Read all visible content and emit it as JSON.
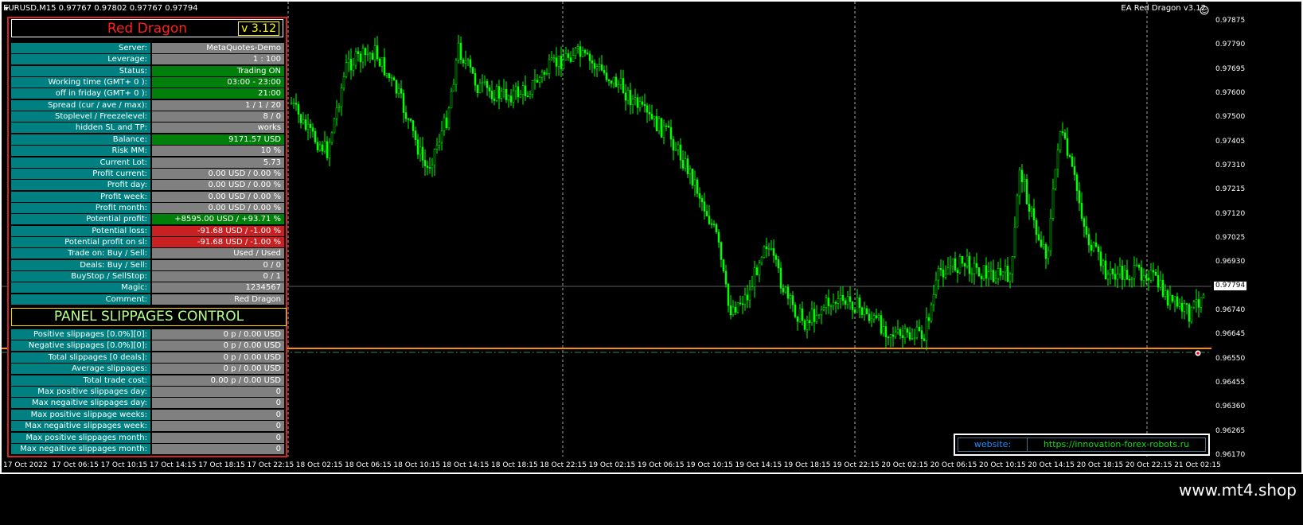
{
  "symbol": {
    "text": "EURUSD,M15  0.97767 0.97802 0.97767 0.97794"
  },
  "ea_label": "EA Red Dragon v3.12",
  "panel": {
    "title": "Red Dragon",
    "version": "v 3.12",
    "rows": [
      {
        "label": "Server:",
        "value": "MetaQuotes-Demo",
        "style": "gray"
      },
      {
        "label": "Leverage:",
        "value": "1 : 100",
        "style": "gray"
      },
      {
        "label": "Status:",
        "value": "Trading ON",
        "style": "green"
      },
      {
        "label": "Working time (GMT+ 0 ):",
        "value": "03:00 - 23:00",
        "style": "green"
      },
      {
        "label": "off in friday (GMT+ 0 ):",
        "value": "21:00",
        "style": "green"
      },
      {
        "label": "Spread (cur / ave / max):",
        "value": "1 / 1 / 20",
        "style": "gray"
      },
      {
        "label": "Stoplevel  /  Freezelevel:",
        "value": "8  /  0",
        "style": "gray"
      },
      {
        "label": "hidden SL and TP:",
        "value": "works",
        "style": "gray"
      },
      {
        "label": "Balance:",
        "value": "9171.57 USD",
        "style": "green"
      },
      {
        "label": "Risk MM:",
        "value": "10 %",
        "style": "gray"
      },
      {
        "label": "Current Lot:",
        "value": "5.73",
        "style": "gray"
      },
      {
        "label": "Profit current:",
        "value": "0.00 USD / 0.00 %",
        "style": "gray"
      },
      {
        "label": "Profit day:",
        "value": "0.00 USD / 0.00 %",
        "style": "gray"
      },
      {
        "label": "Profit week:",
        "value": "0.00 USD / 0.00 %",
        "style": "gray"
      },
      {
        "label": "Profit month:",
        "value": "0.00 USD / 0.00 %",
        "style": "gray"
      },
      {
        "label": "Potential profit:",
        "value": "+8595.00 USD / +93.71 %",
        "style": "green"
      },
      {
        "label": "Potential loss:",
        "value": "-91.68 USD / -1.00 %",
        "style": "red"
      },
      {
        "label": "Potential profit on sl:",
        "value": "-91.68 USD / -1.00 %",
        "style": "red"
      },
      {
        "label": "Trade on: Buy  /  Sell:",
        "value": "Used  /  Used",
        "style": "gray"
      },
      {
        "label": "Deals: Buy / Sell:",
        "value": "0  /  0",
        "style": "gray"
      },
      {
        "label": "BuyStop / SellStop:",
        "value": "0  /  1",
        "style": "gray"
      },
      {
        "label": "Magic:",
        "value": "1234567",
        "style": "gray"
      },
      {
        "label": "Comment:",
        "value": "Red Dragon",
        "style": "gray"
      }
    ],
    "slippage_title": "PANEL SLIPPAGES CONTROL",
    "slippage_rows": [
      {
        "label": "Positive slippages [0.0%][0]:",
        "value": "0 p / 0.00 USD"
      },
      {
        "label": "Negative slippages [0.0%][0]:",
        "value": "0 p / 0.00 USD"
      },
      {
        "label": "Total slippages [0 deals]:",
        "value": "0 p / 0.00 USD"
      },
      {
        "label": "Average slippages:",
        "value": "0 p / 0.00 USD"
      },
      {
        "label": "Total trade cost:",
        "value": "0.00 p / 0.00 USD"
      },
      {
        "label": "Max positive slippages day:",
        "value": "0"
      },
      {
        "label": "Max negaitive slippages day:",
        "value": "0"
      },
      {
        "label": "Max positive slippage weeks:",
        "value": "0"
      },
      {
        "label": "Max negaitive slippages week:",
        "value": "0"
      },
      {
        "label": "Max positive slippages month:",
        "value": "0"
      },
      {
        "label": "Max negaitive slippages month:",
        "value": "0"
      }
    ]
  },
  "website": {
    "label": "website:",
    "url": "https://innovation-forex-robots.ru"
  },
  "price_scale": [
    "0.97875",
    "0.97790",
    "0.97695",
    "0.97600",
    "0.97500",
    "0.97405",
    "0.97310",
    "0.97215",
    "0.97120",
    "0.97025",
    "0.96930",
    "0.96835",
    "0.96740",
    "0.96645",
    "0.96550",
    "0.96455",
    "0.96360",
    "0.96265",
    "0.96170"
  ],
  "bid_price": "0.97794",
  "time_axis": [
    "17 Oct 2022",
    "17 Oct 06:15",
    "17 Oct 10:15",
    "17 Oct 14:15",
    "17 Oct 18:15",
    "17 Oct 22:15",
    "18 Oct 02:15",
    "18 Oct 06:15",
    "18 Oct 10:15",
    "18 Oct 14:15",
    "18 Oct 18:15",
    "18 Oct 22:15",
    "19 Oct 02:15",
    "19 Oct 06:15",
    "19 Oct 10:15",
    "19 Oct 14:15",
    "19 Oct 18:15",
    "19 Oct 22:15",
    "20 Oct 02:15",
    "20 Oct 06:15",
    "20 Oct 10:15",
    "20 Oct 14:15",
    "20 Oct 18:15",
    "20 Oct 22:15",
    "21 Oct 02:15"
  ],
  "footer_site": "www.mt4.shop",
  "colors": {
    "candles": "#00ff00",
    "background": "#000000",
    "order_line": "#ff8c00",
    "stop_line": "#2e8b57"
  }
}
